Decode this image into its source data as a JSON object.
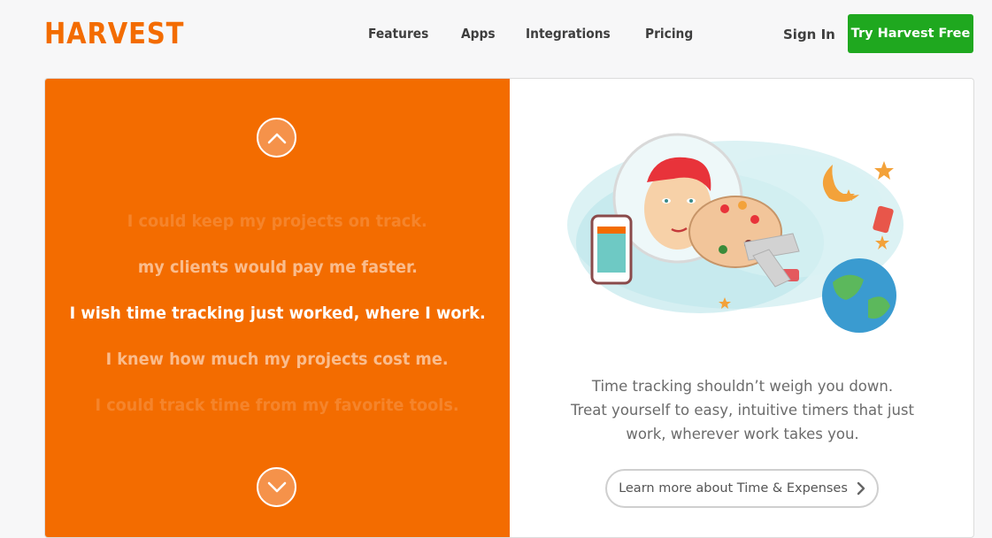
{
  "header": {
    "logo": "HARVEST",
    "nav": [
      "Features",
      "Apps",
      "Integrations",
      "Pricing"
    ],
    "sign_in": "Sign In",
    "cta": "Try Harvest Free"
  },
  "carousel": {
    "phrases": [
      "I could keep my projects on track.",
      "my clients would pay me faster.",
      "I wish time tracking just worked, where I work.",
      "I knew how much my projects cost me.",
      "I could track time from my favorite tools."
    ],
    "up_icon": "chevron-up-icon",
    "down_icon": "chevron-down-icon"
  },
  "feature": {
    "illustration": "astronaut-illustration",
    "description": [
      "Time tracking shouldn’t weigh you down.",
      "Treat yourself to easy, intuitive timers that just",
      "work, wherever work takes you."
    ],
    "learn_more": "Learn more about Time & Expenses"
  },
  "colors": {
    "brand_orange": "#f36c00",
    "cta_green": "#1fa81f"
  }
}
